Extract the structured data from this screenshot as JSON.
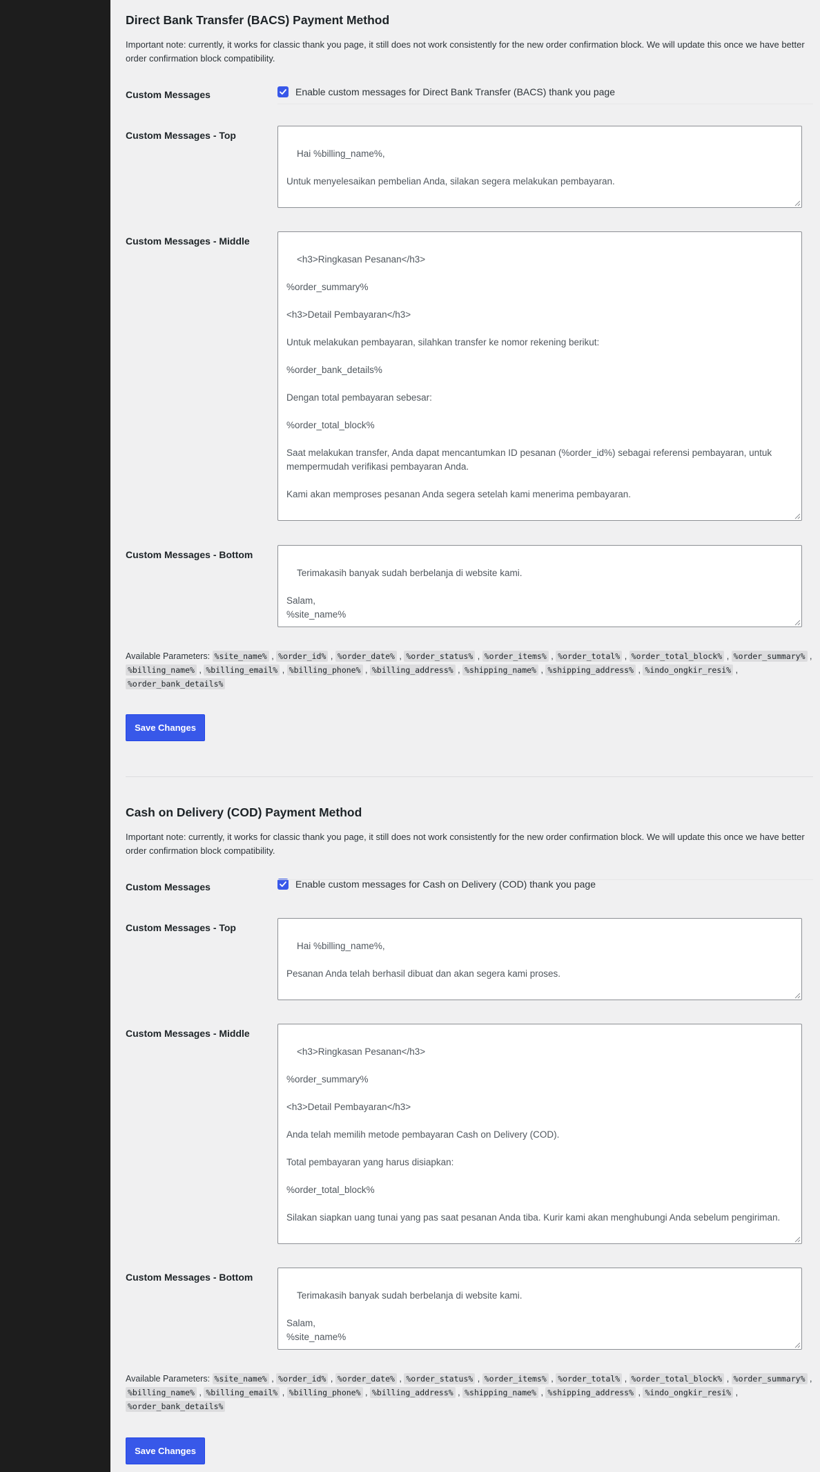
{
  "bacs": {
    "title": "Direct Bank Transfer (BACS) Payment Method",
    "note": "Important note: currently, it works for classic thank you page, it still does not work consistently for the new order confirmation block. We will update this once we have better order confirmation block compatibility.",
    "custom_messages_label": "Custom Messages",
    "checkbox_label": "Enable custom messages for Direct Bank Transfer (BACS) thank you page",
    "top_label": "Custom Messages - Top",
    "top_value": "Hai %billing_name%,\n\nUntuk menyelesaikan pembelian Anda, silakan segera melakukan pembayaran.",
    "middle_label": "Custom Messages - Middle",
    "middle_value": "<h3>Ringkasan Pesanan</h3>\n\n%order_summary%\n\n<h3>Detail Pembayaran</h3>\n\nUntuk melakukan pembayaran, silahkan transfer ke nomor rekening berikut:\n\n%order_bank_details%\n\nDengan total pembayaran sebesar:\n\n%order_total_block%\n\nSaat melakukan transfer, Anda dapat mencantumkan ID pesanan (%order_id%) sebagai referensi pembayaran, untuk mempermudah verifikasi pembayaran Anda.\n\nKami akan memproses pesanan Anda segera setelah kami menerima pembayaran.",
    "bottom_label": "Custom Messages - Bottom",
    "bottom_value": "Terimakasih banyak sudah berbelanja di website kami.\n\nSalam,\n%site_name%",
    "save_label": "Save Changes"
  },
  "cod": {
    "title": "Cash on Delivery (COD) Payment Method",
    "note": "Important note: currently, it works for classic thank you page, it still does not work consistently for the new order confirmation block. We will update this once we have better order confirmation block compatibility.",
    "custom_messages_label": "Custom Messages",
    "checkbox_label": "Enable custom messages for Cash on Delivery (COD) thank you page",
    "top_label": "Custom Messages - Top",
    "top_value": "Hai %billing_name%,\n\nPesanan Anda telah berhasil dibuat dan akan segera kami proses.",
    "middle_label": "Custom Messages - Middle",
    "middle_value": "<h3>Ringkasan Pesanan</h3>\n\n%order_summary%\n\n<h3>Detail Pembayaran</h3>\n\nAnda telah memilih metode pembayaran Cash on Delivery (COD).\n\nTotal pembayaran yang harus disiapkan:\n\n%order_total_block%\n\nSilakan siapkan uang tunai yang pas saat pesanan Anda tiba. Kurir kami akan menghubungi Anda sebelum pengiriman.",
    "bottom_label": "Custom Messages - Bottom",
    "bottom_value": "Terimakasih banyak sudah berbelanja di website kami.\n\nSalam,\n%site_name%",
    "save_label": "Save Changes"
  },
  "params_label": "Available Parameters:",
  "parameters": [
    "%site_name%",
    "%order_id%",
    "%order_date%",
    "%order_status%",
    "%order_items%",
    "%order_total%",
    "%order_total_block%",
    "%order_summary%",
    "%billing_name%",
    "%billing_email%",
    "%billing_phone%",
    "%billing_address%",
    "%shipping_name%",
    "%shipping_address%",
    "%indo_ongkir_resi%",
    "%order_bank_details%"
  ],
  "colors": {
    "accent": "#3858e9",
    "sidebar": "#1d1d1d",
    "background": "#f0f0f1"
  },
  "icons": {
    "checkbox": "checkmark-icon",
    "resize": "resize-grip-icon"
  }
}
